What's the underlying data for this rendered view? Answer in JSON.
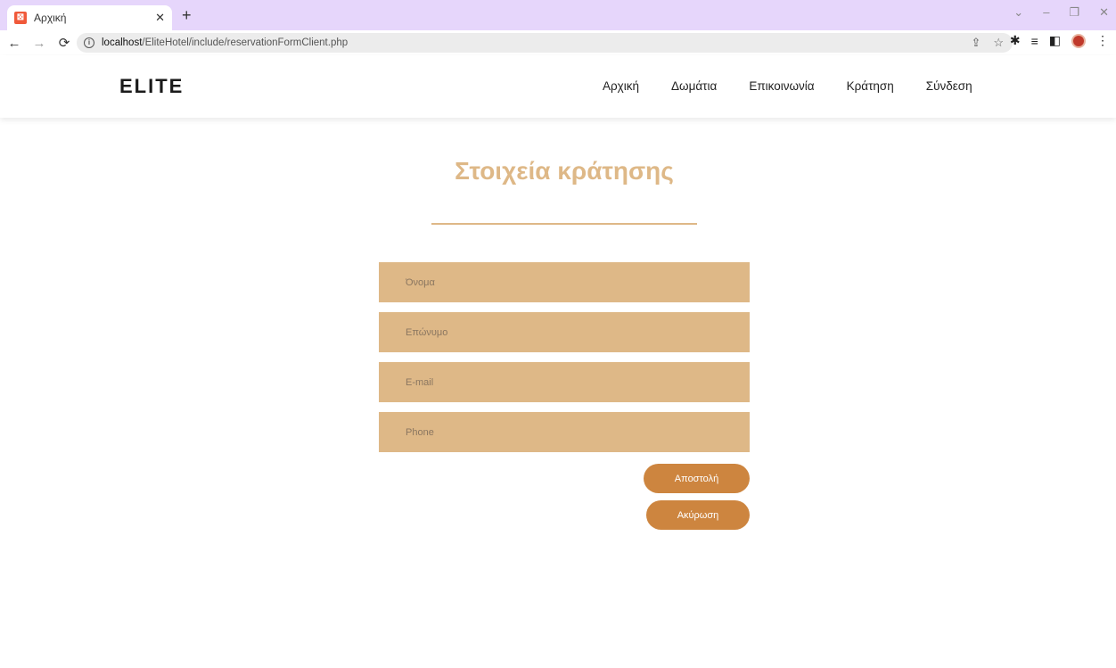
{
  "browser": {
    "tab_title": "Αρχική",
    "favicon_glyph": "⊠",
    "url_host": "localhost",
    "url_path": "/EliteHotel/include/reservationFormClient.php"
  },
  "site": {
    "logo": "ELITE",
    "nav": [
      "Αρχική",
      "Δωμάτια",
      "Επικοινωνία",
      "Κράτηση",
      "Σύνδεση"
    ]
  },
  "form": {
    "title": "Στοιχεία κράτησης",
    "fields": [
      {
        "placeholder": "Όνομα"
      },
      {
        "placeholder": "Επώνυμο"
      },
      {
        "placeholder": "E-mail"
      },
      {
        "placeholder": "Phone"
      }
    ],
    "submit_label": "Αποστολή",
    "cancel_label": "Ακύρωση"
  },
  "colors": {
    "accent": "#deb887",
    "button": "#cd853f",
    "tabstrip": "#e6d6fb"
  }
}
